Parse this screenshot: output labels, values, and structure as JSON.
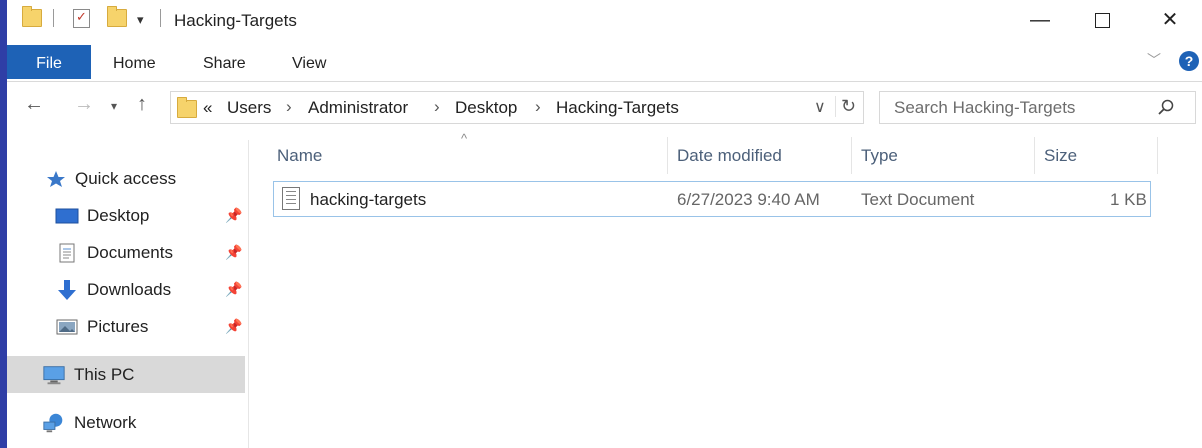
{
  "window": {
    "title": "Hacking-Targets",
    "controls": {
      "minimize": "—",
      "maximize": "☐",
      "close": "✕"
    }
  },
  "ribbon": {
    "tabs": [
      "File",
      "Home",
      "Share",
      "View"
    ],
    "help": "?"
  },
  "address_bar": {
    "overflow": "«",
    "crumbs": [
      "Users",
      "Administrator",
      "Desktop",
      "Hacking-Targets"
    ]
  },
  "search": {
    "placeholder": "Search Hacking-Targets"
  },
  "nav_pane": {
    "quick_access": "Quick access",
    "pinned": [
      "Desktop",
      "Documents",
      "Downloads",
      "Pictures"
    ],
    "this_pc": "This PC",
    "network": "Network",
    "selected": "This PC"
  },
  "file_list": {
    "columns": [
      "Name",
      "Date modified",
      "Type",
      "Size"
    ],
    "rows": [
      {
        "name": "hacking-targets",
        "date_modified": "6/27/2023 9:40 AM",
        "type": "Text Document",
        "size": "1 KB"
      }
    ]
  },
  "colors": {
    "accent": "#1e62b6",
    "background": "#2f3ea6",
    "selected_row_border": "#99c3e8"
  }
}
